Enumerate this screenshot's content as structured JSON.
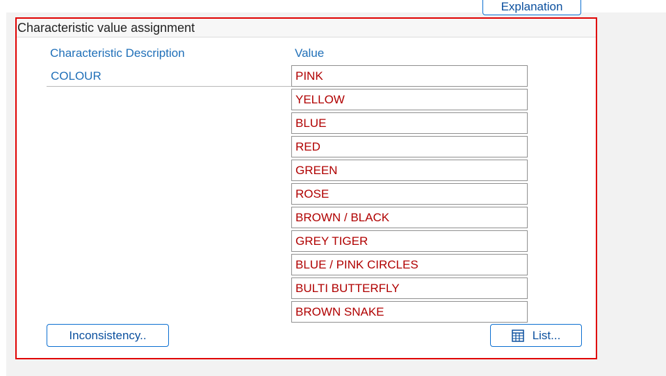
{
  "header": {
    "explanation_label": "Explanation"
  },
  "panel": {
    "title": "Characteristic value assignment",
    "columns": {
      "description": "Characteristic Description",
      "value": "Value"
    },
    "characteristic": {
      "name": "COLOUR",
      "values": [
        "PINK",
        "YELLOW",
        "BLUE",
        "RED",
        "GREEN",
        "ROSE",
        "BROWN / BLACK",
        "GREY TIGER",
        "BLUE / PINK CIRCLES",
        "BULTI BUTTERFLY",
        "BROWN SNAKE"
      ]
    },
    "buttons": {
      "inconsistency_label": "Inconsistency..",
      "list_label": "List...",
      "list_icon": "list-table-icon"
    }
  },
  "colors": {
    "accent": "#0a6ed1",
    "value_text": "#b00000",
    "frame_highlight": "#e00000"
  }
}
